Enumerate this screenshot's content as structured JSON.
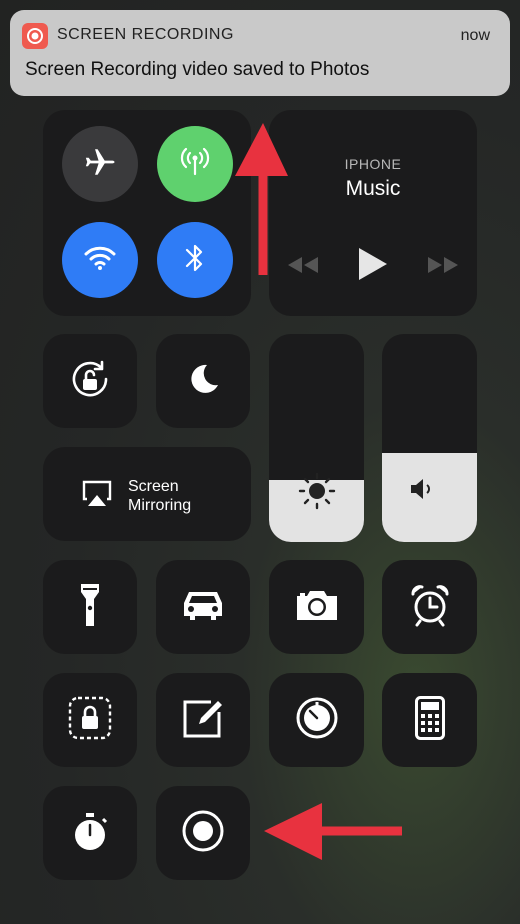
{
  "notification": {
    "app_name": "SCREEN RECORDING",
    "time": "now",
    "message": "Screen Recording video saved to Photos",
    "accent": "#ef5a4f"
  },
  "connectivity": {
    "airplane": {
      "icon": "airplane-icon",
      "active": false
    },
    "cellular": {
      "icon": "cellular-icon",
      "active": true,
      "color": "#5fd16e"
    },
    "wifi": {
      "icon": "wifi-icon",
      "active": true,
      "color": "#2f7cf6"
    },
    "bluetooth": {
      "icon": "bluetooth-icon",
      "active": true,
      "color": "#2f7cf6"
    }
  },
  "music": {
    "source": "IPHONE",
    "title": "Music"
  },
  "screen_mirroring": {
    "line1": "Screen",
    "line2": "Mirroring"
  },
  "brightness": {
    "level": 0.3
  },
  "volume": {
    "level": 0.43
  },
  "colors": {
    "arrow": "#e8323f",
    "tile": "#1b1b1c",
    "slider_fill": "#e3e3e3"
  },
  "shortcuts": [
    "orientation-lock-icon",
    "do-not-disturb-icon",
    "flashlight-icon",
    "car-icon",
    "camera-icon",
    "alarm-icon",
    "guided-access-icon",
    "notes-icon",
    "timer-icon",
    "calculator-icon",
    "stopwatch-icon",
    "screen-record-icon"
  ]
}
